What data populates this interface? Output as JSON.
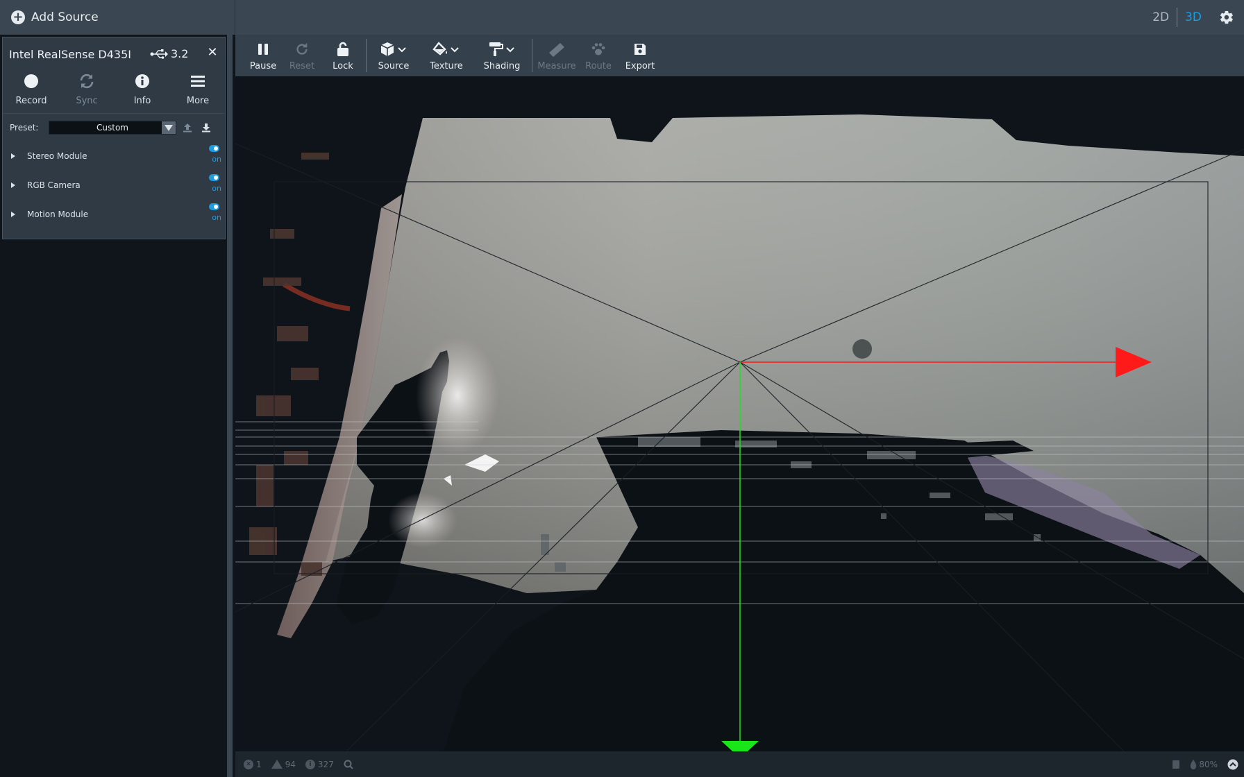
{
  "topbar": {
    "add_source_label": "Add Source",
    "view_2d": "2D",
    "view_3d": "3D",
    "active_view": "3D"
  },
  "device": {
    "name": "Intel RealSense D435I",
    "usb_version": "3.2",
    "actions": [
      {
        "label": "Record",
        "icon": "record-icon",
        "enabled": true
      },
      {
        "label": "Sync",
        "icon": "sync-icon",
        "enabled": false
      },
      {
        "label": "Info",
        "icon": "info-icon",
        "enabled": true
      },
      {
        "label": "More",
        "icon": "menu-icon",
        "enabled": true
      }
    ],
    "preset_label": "Preset:",
    "preset_value": "Custom",
    "modules": [
      {
        "name": "Stereo Module",
        "state": "on"
      },
      {
        "name": "RGB Camera",
        "state": "on"
      },
      {
        "name": "Motion Module",
        "state": "on"
      }
    ]
  },
  "toolbar": {
    "pause": "Pause",
    "reset": "Reset",
    "lock": "Lock",
    "source": "Source",
    "texture": "Texture",
    "shading": "Shading",
    "measure": "Measure",
    "route": "Route",
    "export": "Export"
  },
  "statusbar": {
    "errors": "1",
    "warnings": "94",
    "info": "327",
    "zoom": "80%"
  },
  "colors": {
    "accent": "#1b9de2",
    "x_axis": "#ff1a1a",
    "y_axis": "#19e619",
    "toolbar_bg": "#34404b",
    "topbar_bg": "#3a4651"
  }
}
